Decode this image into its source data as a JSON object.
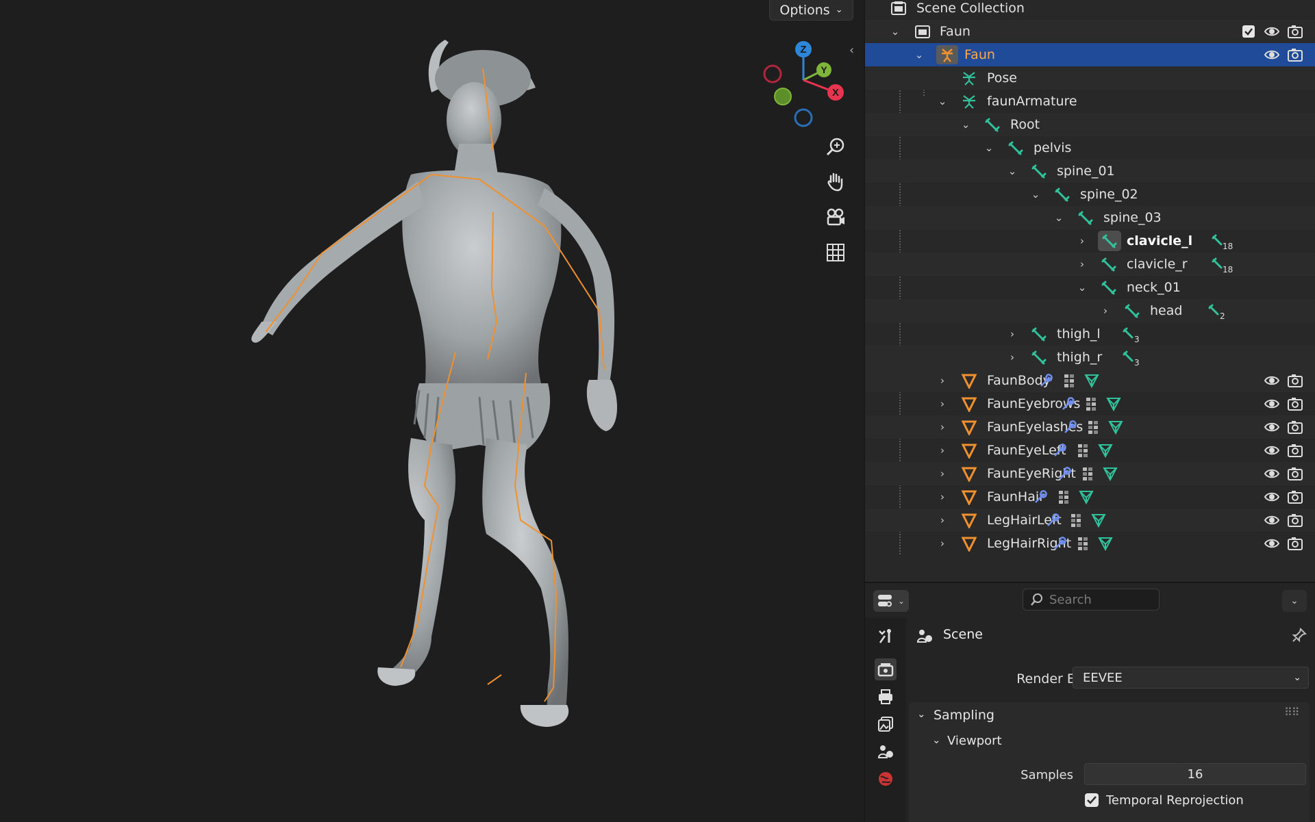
{
  "viewport": {
    "options_label": "Options",
    "gizmo_axes": {
      "z": "Z",
      "y": "Y",
      "x": "X"
    },
    "nav_icons": [
      "zoom-icon",
      "hand-pan-icon",
      "camera-view-icon",
      "grid-toggle-icon"
    ]
  },
  "outliner": {
    "scene_collection_label": "Scene Collection",
    "collection_label": "Faun",
    "selected_object_label": "Faun",
    "pose_label": "Pose",
    "armature_label": "faunArmature",
    "bones": {
      "root": "Root",
      "pelvis": "pelvis",
      "spine_01": "spine_01",
      "spine_02": "spine_02",
      "spine_03": "spine_03",
      "clavicle_l": "clavicle_l",
      "clavicle_l_count": "18",
      "clavicle_r": "clavicle_r",
      "clavicle_r_count": "18",
      "neck_01": "neck_01",
      "head": "head",
      "head_count": "2",
      "thigh_l": "thigh_l",
      "thigh_l_count": "3",
      "thigh_r": "thigh_r",
      "thigh_r_count": "3"
    },
    "meshes": [
      "FaunBody",
      "FaunEyebrows",
      "FaunEyelashes",
      "FaunEyeLeft",
      "FaunEyeRight",
      "FaunHair",
      "LegHairLeft",
      "LegHairRight"
    ]
  },
  "properties": {
    "search_placeholder": "Search",
    "context_label": "Scene",
    "render_engine_label": "Render Engine",
    "render_engine_value": "EEVEE",
    "sampling_label": "Sampling",
    "viewport_label": "Viewport",
    "samples_label": "Samples",
    "samples_value": "16",
    "temporal_reprojection_label": "Temporal Reprojection",
    "temporal_reprojection_checked": true
  },
  "colors": {
    "selection": "#1f4b99",
    "selected_text": "#ffa94d",
    "bone_green": "#2fc29b",
    "mesh_orange": "#f0902e",
    "modifier_blue": "#6f8ff0",
    "axis_x": "#e8344f",
    "axis_y": "#7eb53a",
    "axis_z": "#2d86d8"
  }
}
